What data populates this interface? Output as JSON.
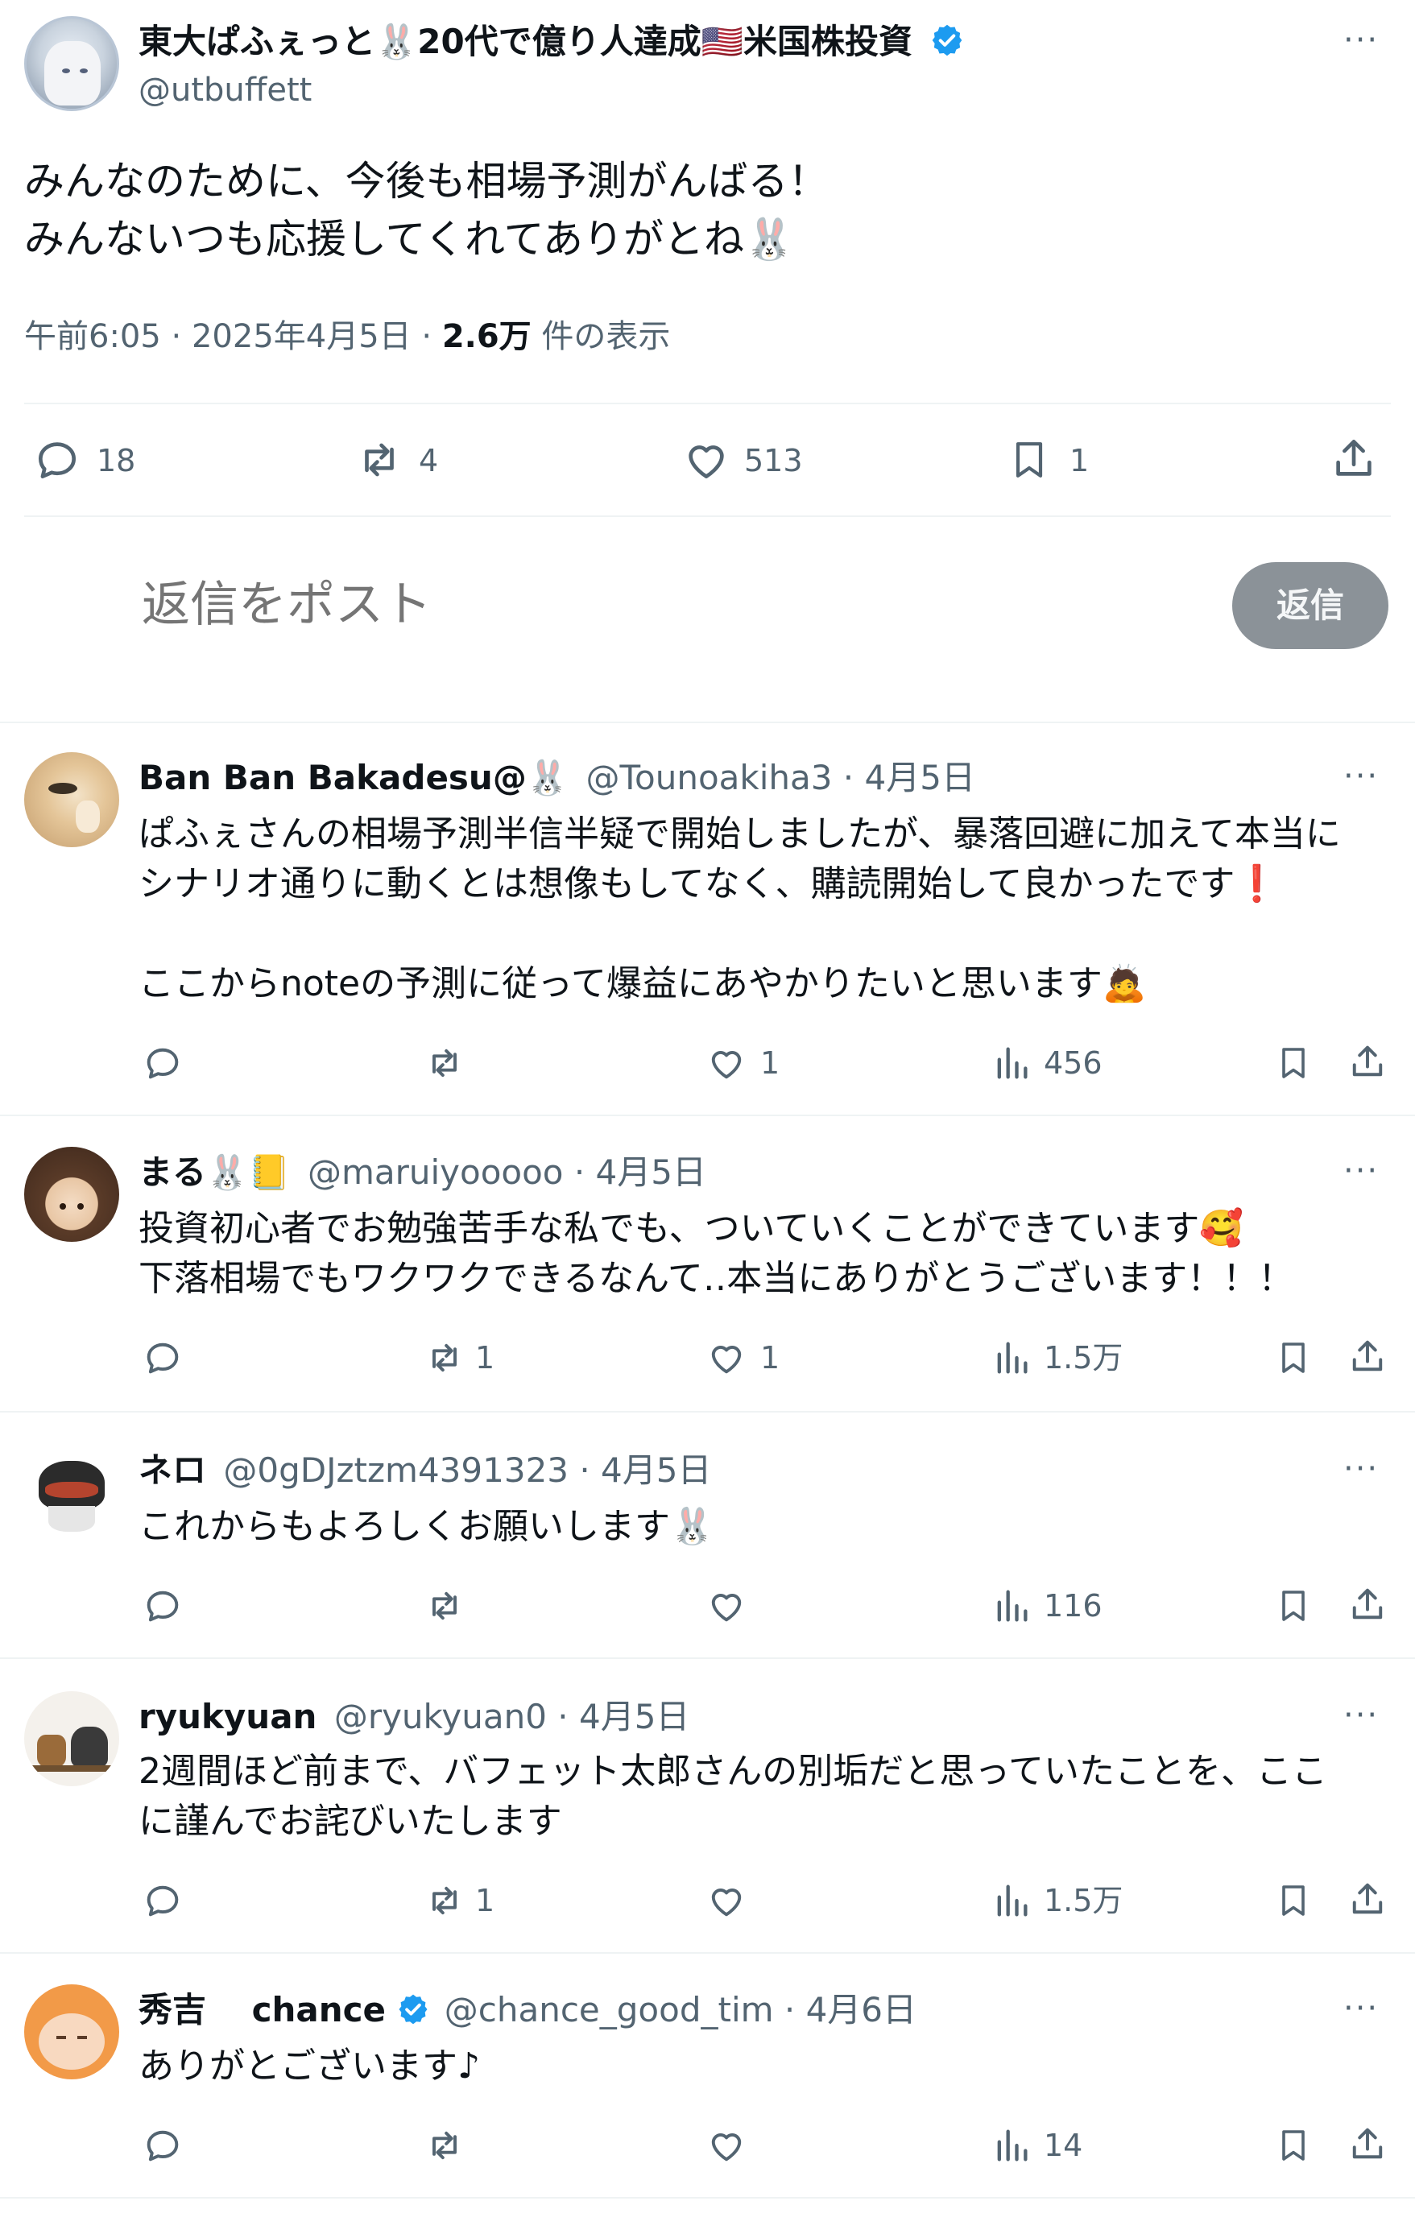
{
  "main_post": {
    "display_name": "東大ぱふぇっと🐰20代で億り人達成🇺🇸米国株投資",
    "handle": "@utbuffett",
    "text_line1": "みんなのために、今後も相場予測がんばる！",
    "text_line2": "みんないつも応援してくれてありがとね🐰",
    "timestamp": "午前6:05 · 2025年4月5日 · ",
    "views_count": "2.6万",
    "views_label": " 件の表示",
    "stats": {
      "replies": "18",
      "reposts": "4",
      "likes": "513",
      "bookmarks": "1"
    }
  },
  "composer": {
    "placeholder": "返信をポスト",
    "reply_button": "返信"
  },
  "replies": [
    {
      "name": "Ban Ban Bakadesu@🐰",
      "meta": "@Tounoakiha3 · 4月5日",
      "lines": [
        "ぱふぇさんの相場予測半信半疑で開始しましたが、暴落回避に加えて本当に",
        "シナリオ通りに動くとは想像もしてなく、購読開始して良かったです❗",
        "",
        "ここからnoteの予測に従って爆益にあやかりたいと思います🙇"
      ],
      "reposts": "",
      "likes": "1",
      "views": "456"
    },
    {
      "name": "まる🐰📒",
      "meta": "@maruiyooooo · 4月5日",
      "lines": [
        "投資初心者でお勉強苦手な私でも、ついていくことができています🥰",
        "下落相場でもワクワクできるなんて‥本当にありがとうございます！！！"
      ],
      "reposts": "1",
      "likes": "1",
      "views": "1.5万"
    },
    {
      "name": "ネロ",
      "meta": "@0gDJztzm4391323 · 4月5日",
      "lines": [
        "これからもよろしくお願いします🐰"
      ],
      "reposts": "",
      "likes": "",
      "views": "116"
    },
    {
      "name": "ryukyuan",
      "meta": "@ryukyuan0 · 4月5日",
      "lines": [
        "2週間ほど前まで、バフェット太郎さんの別垢だと思っていたことを、ここ",
        "に謹んでお詫びいたします"
      ],
      "reposts": "1",
      "likes": "",
      "views": "1.5万"
    },
    {
      "name": "秀吉　 chance",
      "meta": "@chance_good_tim · 4月6日",
      "lines": [
        "ありがとございます♪"
      ],
      "reposts": "",
      "likes": "",
      "views": "14"
    }
  ],
  "colors": {
    "verified": "#1d9bf0",
    "muted": "#536471",
    "divider": "#eff3f4",
    "reply_button_bg": "#8b9298"
  }
}
